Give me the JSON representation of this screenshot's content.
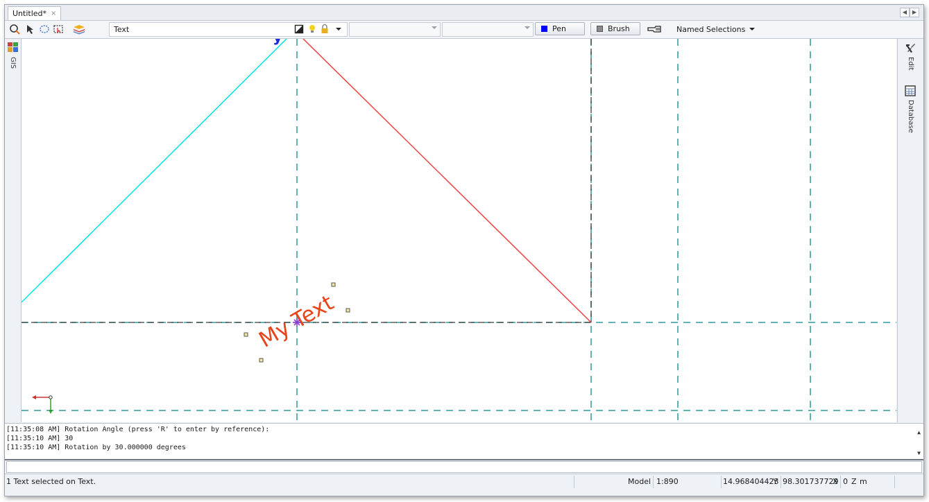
{
  "tab": {
    "title": "Untitled*",
    "close": "×"
  },
  "toolbar": {
    "layer_text": "Text",
    "pen_label": "Pen",
    "brush_label": "Brush",
    "named_selections": "Named Selections",
    "pen_color": "#0000ff",
    "brush_color": "#8a8a8a"
  },
  "left_panel": {
    "gis_label": "GIS"
  },
  "right_panel": {
    "edit_label": "Edit",
    "database_label": "Database"
  },
  "canvas": {
    "text_object": "My Text",
    "text_color": "#e8431a",
    "rotation_deg": 30,
    "cyan_line_color": "#00e5e5",
    "red_line_color": "#f04040",
    "grid_color": "#2a9a9a"
  },
  "command_log": [
    "[11:35:08 AM] Rotation Angle (press 'R' to enter by reference):",
    "[11:35:10 AM] 30",
    "[11:35:10 AM] Rotation by 30.000000 degrees"
  ],
  "status": {
    "message": "1 Text selected on Text.",
    "mode": "Model",
    "scale": "1:890",
    "y_value": "14.968404423",
    "y_label": "Y",
    "x_value": "98.301737729",
    "x_label": "X",
    "z_value": "0",
    "z_label": "Z",
    "unit": "m"
  }
}
